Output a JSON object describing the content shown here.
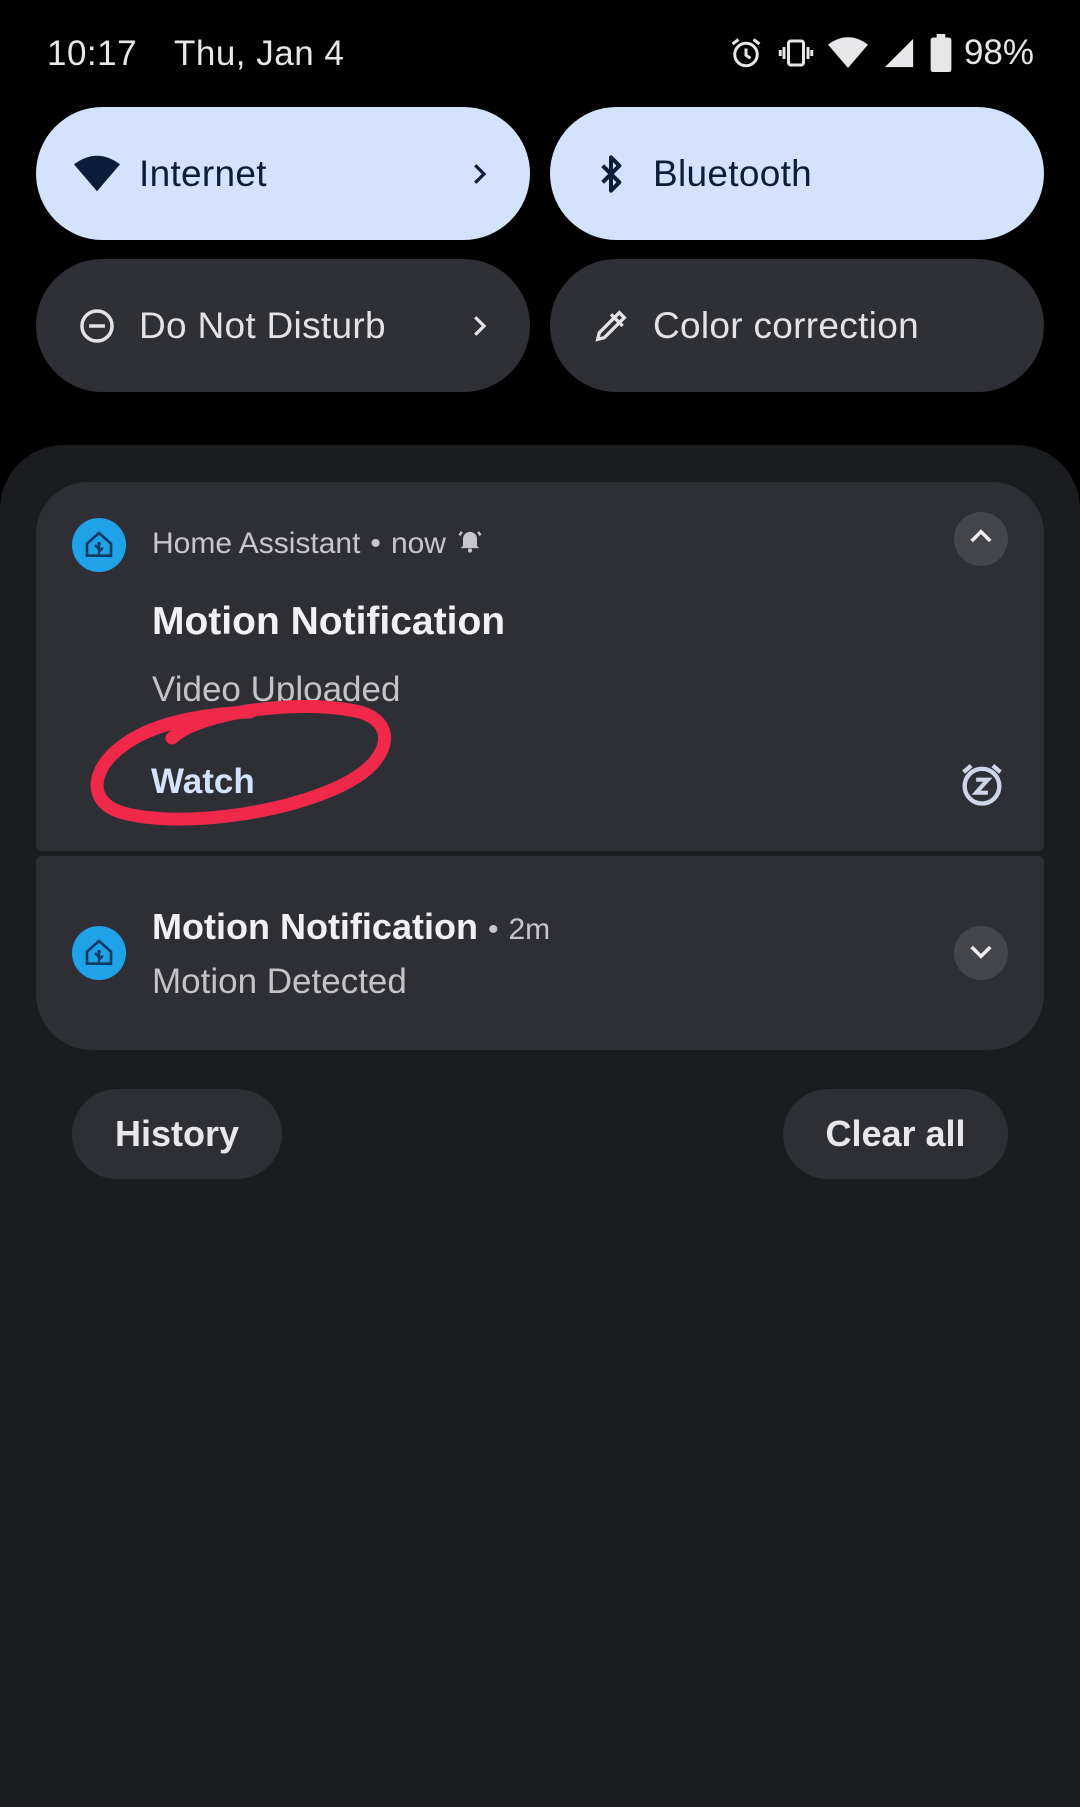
{
  "status_bar": {
    "time": "10:17",
    "date": "Thu, Jan 4",
    "battery": "98%",
    "icons": [
      "alarm-icon",
      "vibrate-icon",
      "wifi-icon",
      "cell-signal-icon",
      "battery-icon"
    ]
  },
  "quick_settings": {
    "tiles": [
      {
        "label": "Internet",
        "icon": "wifi-icon",
        "state": "on",
        "has_chevron": true
      },
      {
        "label": "Bluetooth",
        "icon": "bluetooth-icon",
        "state": "on",
        "has_chevron": false
      },
      {
        "label": "Do Not Disturb",
        "icon": "dnd-icon",
        "state": "off",
        "has_chevron": true
      },
      {
        "label": "Color correction",
        "icon": "eyedropper-icon",
        "state": "off",
        "has_chevron": false
      }
    ]
  },
  "notifications": [
    {
      "app": "Home Assistant",
      "time": "now",
      "title": "Motion Notification",
      "text": "Video Uploaded",
      "action": "Watch",
      "expanded": true,
      "icons": [
        "home-assistant-icon",
        "alert-bell-icon",
        "collapse-icon",
        "snooze-icon"
      ]
    },
    {
      "title": "Motion Notification",
      "time": "2m",
      "text": "Motion Detected",
      "expanded": false,
      "icons": [
        "home-assistant-icon",
        "expand-icon"
      ]
    }
  ],
  "footer": {
    "history": "History",
    "clear_all": "Clear all"
  },
  "colors": {
    "tile_active": "#d3e3fd",
    "tile_inactive": "#2f3036",
    "card": "#2e2f35",
    "shade": "#1b1c20",
    "app_icon": "#1fa2e8",
    "annotation_circle": "#f0294a"
  }
}
